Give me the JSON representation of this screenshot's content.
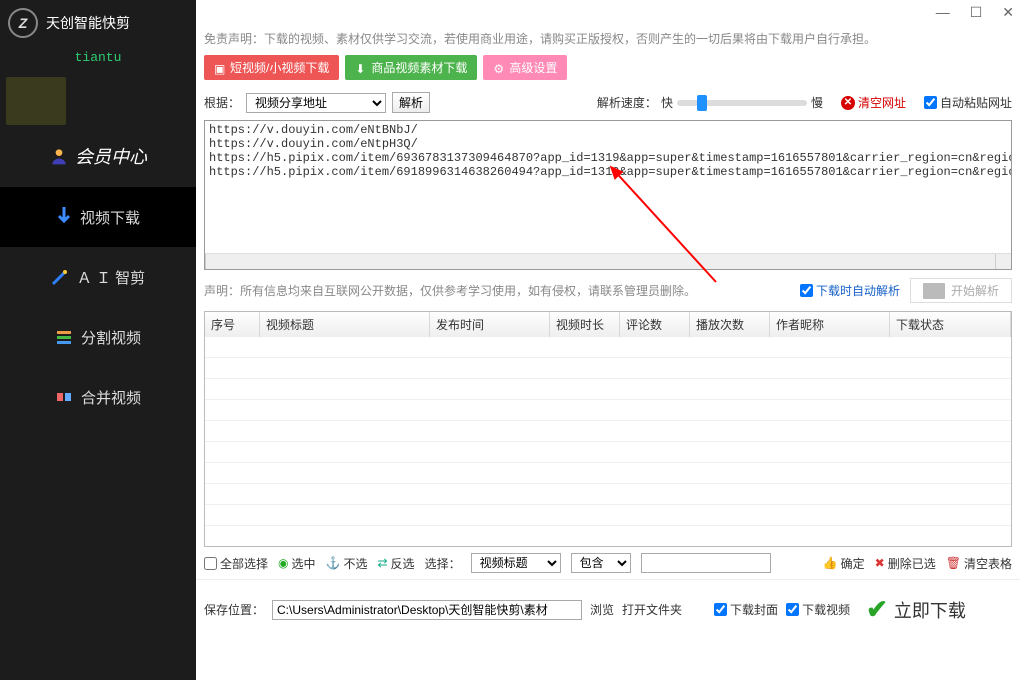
{
  "app": {
    "title": "天创智能快剪",
    "subtitle": "tiantu"
  },
  "sidebar": {
    "member": "会员中心",
    "items": [
      {
        "label": "视频下载"
      },
      {
        "label": "Ａ Ｉ 智剪"
      },
      {
        "label": "分割视频"
      },
      {
        "label": "合并视频"
      }
    ]
  },
  "disclaimer": "免责声明：下载的视频、素材仅供学习交流，若使用商业用途，请购买正版授权，否则产生的一切后果将由下载用户自行承担。",
  "tabs": [
    {
      "label": "短视频/小视频下载"
    },
    {
      "label": "商品视频素材下载"
    },
    {
      "label": "高级设置"
    }
  ],
  "src": {
    "label": "根据：",
    "select": "视频分享地址",
    "parse_btn": "解析",
    "speed_label": "解析速度：",
    "fast": "快",
    "slow": "慢",
    "clear": "清空网址",
    "autopaste": "自动粘贴网址"
  },
  "urls_text": "https://v.douyin.com/eNtBNbJ/\nhttps://v.douyin.com/eNtpH3Q/\nhttps://h5.pipix.com/item/6936783137309464870?app_id=1319&app=super&timestamp=1616557801&carrier_region=cn&region=cn&language=zh&ut\nhttps://h5.pipix.com/item/6918996314638260494?app_id=1319&app=super&timestamp=1616557801&carrier_region=cn&region=cn&language=zh&ut",
  "notice2": "声明：所有信息均来自互联网公开数据，仅供参考学习使用，如有侵权，请联系管理员删除。",
  "autoparse": "下载时自动解析",
  "startparse": "开始解析",
  "table_headers": [
    "序号",
    "视频标题",
    "发布时间",
    "视频时长",
    "评论数",
    "播放次数",
    "作者昵称",
    "下载状态"
  ],
  "actions": {
    "selectall": "全部选择",
    "check": "选中",
    "uncheck": "不选",
    "invert": "反选",
    "sel_label": "选择：",
    "sel_opt": "视频标题",
    "contain": "包含",
    "confirm": "确定",
    "delsel": "删除已选",
    "cleartable": "清空表格"
  },
  "save": {
    "label": "保存位置：",
    "path": "C:\\Users\\Administrator\\Desktop\\天创智能快剪\\素材",
    "browse": "浏览",
    "open": "打开文件夹",
    "dlcover": "下载封面",
    "dlvideo": "下载视频",
    "download": "立即下载"
  }
}
